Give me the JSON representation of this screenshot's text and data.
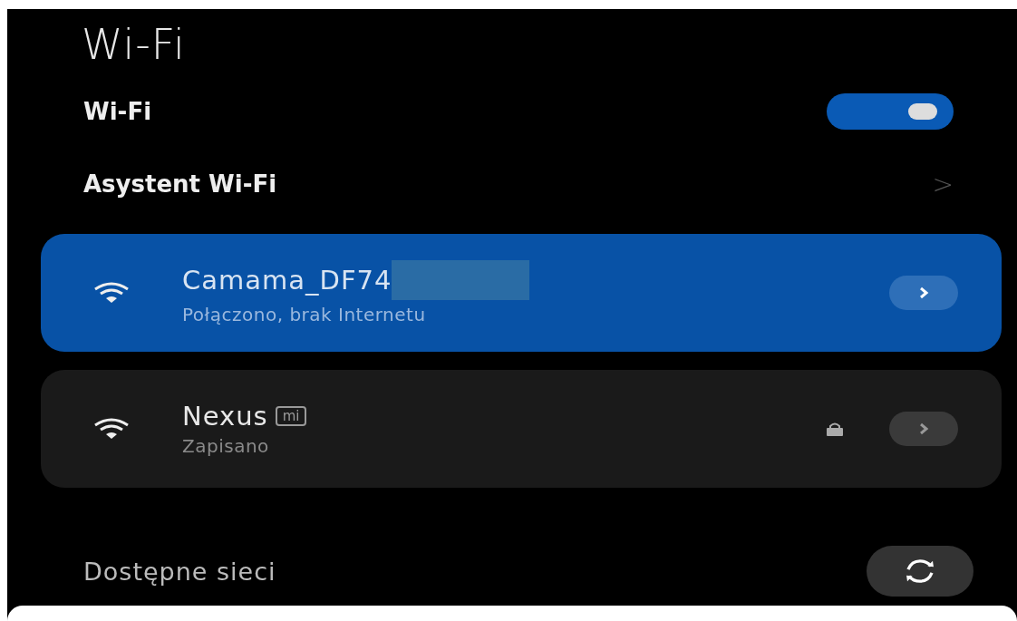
{
  "title": "Wi-Fi",
  "wifi_toggle": {
    "label": "Wi-Fi",
    "on": true
  },
  "assistant": {
    "label": "Asystent Wi-Fi",
    "chevron": ">"
  },
  "networks": [
    {
      "name": "Camama_DF74",
      "status": "Połączono, brak Internetu",
      "selected": true,
      "redacted": true,
      "locked": false
    },
    {
      "name": "Nexus",
      "status": "Zapisano",
      "selected": false,
      "redacted": false,
      "locked": true,
      "badge": "mi"
    }
  ],
  "available": {
    "label": "Dostępne sieci"
  }
}
